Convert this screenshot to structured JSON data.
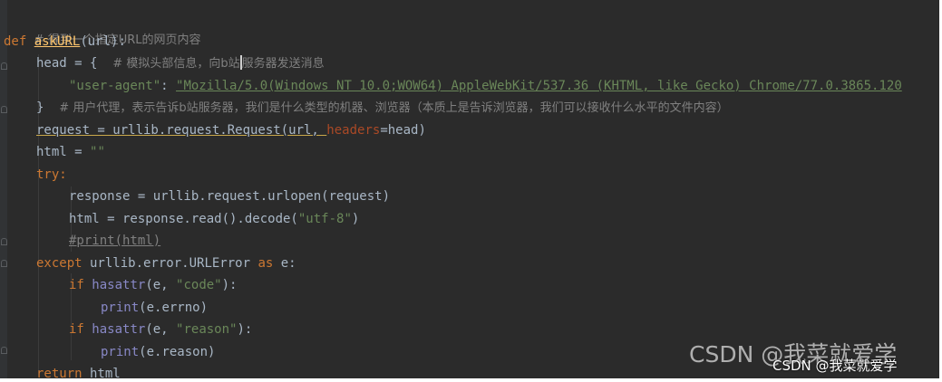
{
  "code": {
    "line1_comment": "# 得到一个指定URL的网页内容",
    "line2_def": "def",
    "line2_fname": "askURL",
    "line2_rest": "(url):",
    "line3_code": "head = {",
    "line3_comment_a": "# 模拟头部信息，向b站",
    "line3_comment_b": "服务器发送消息",
    "line4_key": "\"user-agent\"",
    "line4_colon": ": ",
    "line4_value": "\"Mozilla/5.0(Windows NT 10.0;WOW64) AppleWebKit/537.36 (KHTML, like Gecko) Chrome/77.0.3865.120",
    "line5_brace": "}",
    "line5_comment": "# 用户代理，表示告诉b站服务器，我们是什么类型的机器、浏览器（本质上是告诉浏览器，我们可以接收什么水平的文件内容）",
    "line6_a": "request = urllib.request.Request(url, ",
    "line6_param": "headers",
    "line6_b": "=head)",
    "line7_a": "html = ",
    "line7_str": "\"\"",
    "line8_kw": "try",
    "line8_colon": ":",
    "line9": "response = urllib.request.urlopen(request)",
    "line10_a": "html = response.read().decode(",
    "line10_str": "\"utf-8\"",
    "line10_b": ")",
    "line11": "#print(html)",
    "line12_kw": "except",
    "line12_a": " urllib.error.URLError ",
    "line12_as": "as",
    "line12_b": " e:",
    "line13_if": "if",
    "line13_fn": "hasattr",
    "line13_a": "(e, ",
    "line13_str": "\"code\"",
    "line13_b": "):",
    "line14_fn": "print",
    "line14_a": "(e.errno)",
    "line15_if": "if",
    "line15_fn": "hasattr",
    "line15_a": "(e, ",
    "line15_str": "\"reason\"",
    "line15_b": "):",
    "line16_fn": "print",
    "line16_a": "(e.reason)",
    "line17_kw": "return",
    "line17_a": " html"
  },
  "watermark": {
    "big": "CSDN @我菜就爱学",
    "small": "CSDN @我菜就爱学"
  },
  "colors": {
    "background": "#2b2b2b",
    "keyword": "#cc7832",
    "function_name": "#ffc66d",
    "string": "#6a8759",
    "comment": "#808080",
    "parameter": "#aa4926",
    "builtin": "#8888c6",
    "default_text": "#a9b7c6"
  }
}
